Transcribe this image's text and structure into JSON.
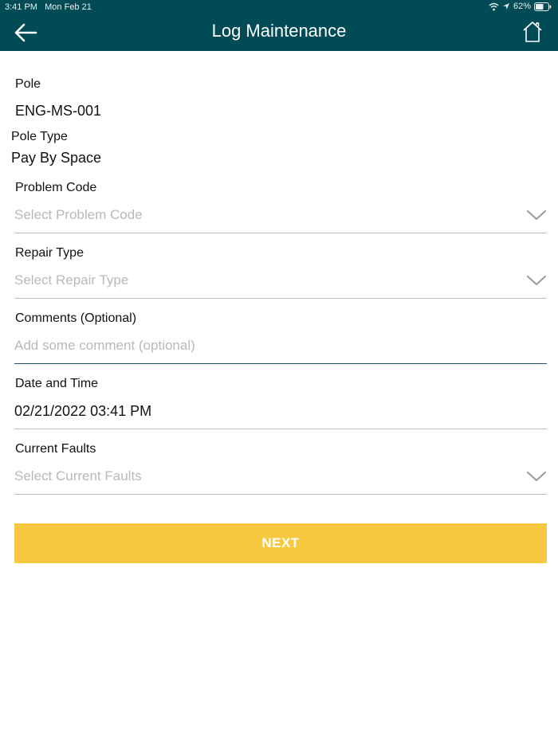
{
  "status_bar": {
    "time": "3:41 PM",
    "date": "Mon Feb 21",
    "battery": "62%"
  },
  "header": {
    "title": "Log Maintenance",
    "back_icon": "arrow-left-icon",
    "home_icon": "home-icon",
    "background": "#004b55"
  },
  "form": {
    "pole": {
      "label": "Pole",
      "value": "ENG-MS-001"
    },
    "pole_type": {
      "label": "Pole Type",
      "value": "Pay By Space"
    },
    "problem_code": {
      "label": "Problem Code",
      "placeholder": "Select Problem Code"
    },
    "repair_type": {
      "label": "Repair Type",
      "placeholder": "Select Repair Type"
    },
    "comments": {
      "label": "Comments (Optional)",
      "placeholder": "Add some comment (optional)"
    },
    "date_time": {
      "label": "Date and Time",
      "value": "02/21/2022 03:41 PM"
    },
    "current_faults": {
      "label": "Current Faults",
      "placeholder": "Select Current Faults"
    }
  },
  "actions": {
    "next_label": "NEXT",
    "next_color": "#f8c940"
  }
}
